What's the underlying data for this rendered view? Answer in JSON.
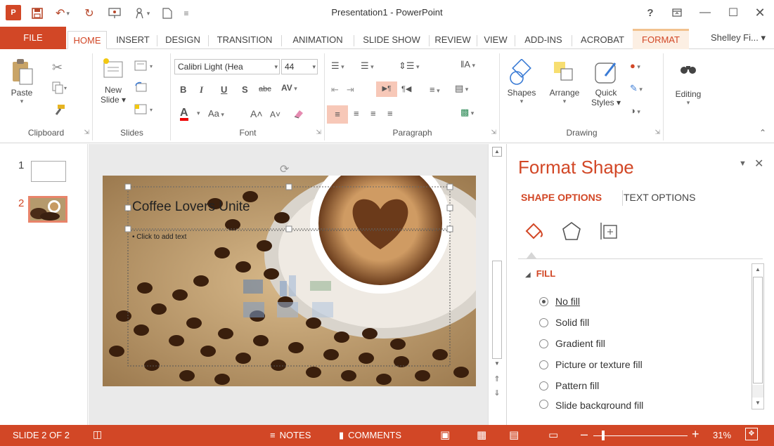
{
  "window": {
    "title": "Presentation1 - PowerPoint",
    "app_icon_label": "P",
    "controls": [
      "help-icon",
      "ribbon-display-icon",
      "minimize-icon",
      "maximize-icon",
      "close-icon"
    ]
  },
  "tabs": {
    "file": "FILE",
    "home": "HOME",
    "insert": "INSERT",
    "design": "DESIGN",
    "transition": "TRANSITION",
    "animation": "ANIMATION",
    "slideshow": "SLIDE SHOW",
    "review": "REVIEW",
    "view": "VIEW",
    "addins": "ADD-INS",
    "acrobat": "ACROBAT",
    "format": "FORMAT",
    "user": "Shelley Fi... ▾"
  },
  "ribbon": {
    "clipboard": {
      "label": "Clipboard",
      "paste": "Paste"
    },
    "slides": {
      "label": "Slides",
      "new_slide_1": "New",
      "new_slide_2": "Slide ▾"
    },
    "font": {
      "label": "Font",
      "font_name": "Calibri Light (Hea",
      "font_size": "44",
      "bold": "B",
      "italic": "I",
      "underline": "U",
      "shadow": "S",
      "strike": "abc",
      "spacing": "AV",
      "color": "A",
      "case": "Aa",
      "grow": "A˄",
      "shrink": "A˅"
    },
    "paragraph": {
      "label": "Paragraph"
    },
    "drawing": {
      "label": "Drawing",
      "shapes": "Shapes",
      "arrange": "Arrange",
      "quick_styles_1": "Quick",
      "quick_styles_2": "Styles ▾"
    },
    "editing": {
      "label": "Editing"
    }
  },
  "thumbnails": [
    {
      "number": "1"
    },
    {
      "number": "2"
    }
  ],
  "slide": {
    "title_text": "Coffee Lovers Unite",
    "body_placeholder": "• Click to add text"
  },
  "format_pane": {
    "title": "Format Shape",
    "tab_shape": "SHAPE OPTIONS",
    "tab_text": "TEXT OPTIONS",
    "section": "FILL",
    "options": [
      {
        "label": "No fill",
        "checked": true
      },
      {
        "label": "Solid fill",
        "checked": false
      },
      {
        "label": "Gradient fill",
        "checked": false
      },
      {
        "label": "Picture or texture fill",
        "checked": false
      },
      {
        "label": "Pattern fill",
        "checked": false
      },
      {
        "label": "Slide background fill",
        "checked": false
      }
    ]
  },
  "status": {
    "slide_of": "SLIDE 2 OF 2",
    "notes": "NOTES",
    "comments": "COMMENTS",
    "zoom": "31%"
  },
  "colors": {
    "accent": "#d24726",
    "ribbon_bg": "#ffffff",
    "format_tab_bg": "#fcefe3"
  }
}
